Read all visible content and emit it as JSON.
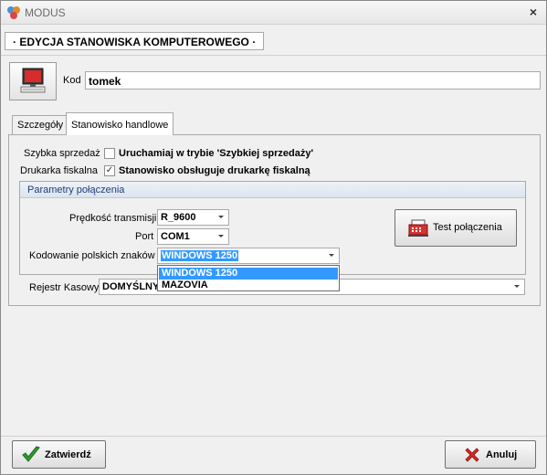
{
  "window": {
    "title": "MODUS",
    "close_glyph": "×"
  },
  "header": {
    "title": "· EDYCJA STANOWISKA KOMPUTEROWEGO ·"
  },
  "kod": {
    "label": "Kod",
    "value": "tomek"
  },
  "tabs": [
    {
      "label": "Szczegóły",
      "active": false
    },
    {
      "label": "Stanowisko handlowe",
      "active": true
    }
  ],
  "szybka": {
    "label": "Szybka sprzedaż",
    "checked": false,
    "text": "Uruchamiaj w trybie 'Szybkiej sprzedaży'"
  },
  "drukarka": {
    "label": "Drukarka fiskalna",
    "checked": true,
    "check_glyph": "✓",
    "text": "Stanowisko obsługuje drukarkę fiskalną"
  },
  "group": {
    "title": "Parametry połączenia",
    "predkosc": {
      "label": "Prędkość transmisji",
      "value": "R_9600"
    },
    "port": {
      "label": "Port",
      "value": "COM1"
    },
    "kodowanie": {
      "label": "Kodowanie polskich znaków",
      "value": "WINDOWS 1250",
      "options": [
        "WINDOWS 1250",
        "MAZOVIA"
      ]
    },
    "test_button": {
      "label": "Test połączenia"
    }
  },
  "rejestr": {
    "label": "Rejestr Kasowy",
    "value": "DOMYŚLNY"
  },
  "footer": {
    "confirm": {
      "label": "Zatwierdź"
    },
    "cancel": {
      "label": "Anuluj"
    }
  },
  "colors": {
    "accent": "#3399ff",
    "group_title": "#1f3d7a",
    "confirm_icon": "#2e9b2e",
    "cancel_icon": "#d42a2a"
  },
  "icons": [
    "app-icon",
    "computer-icon",
    "cash-register-icon",
    "check-icon",
    "x-icon"
  ]
}
